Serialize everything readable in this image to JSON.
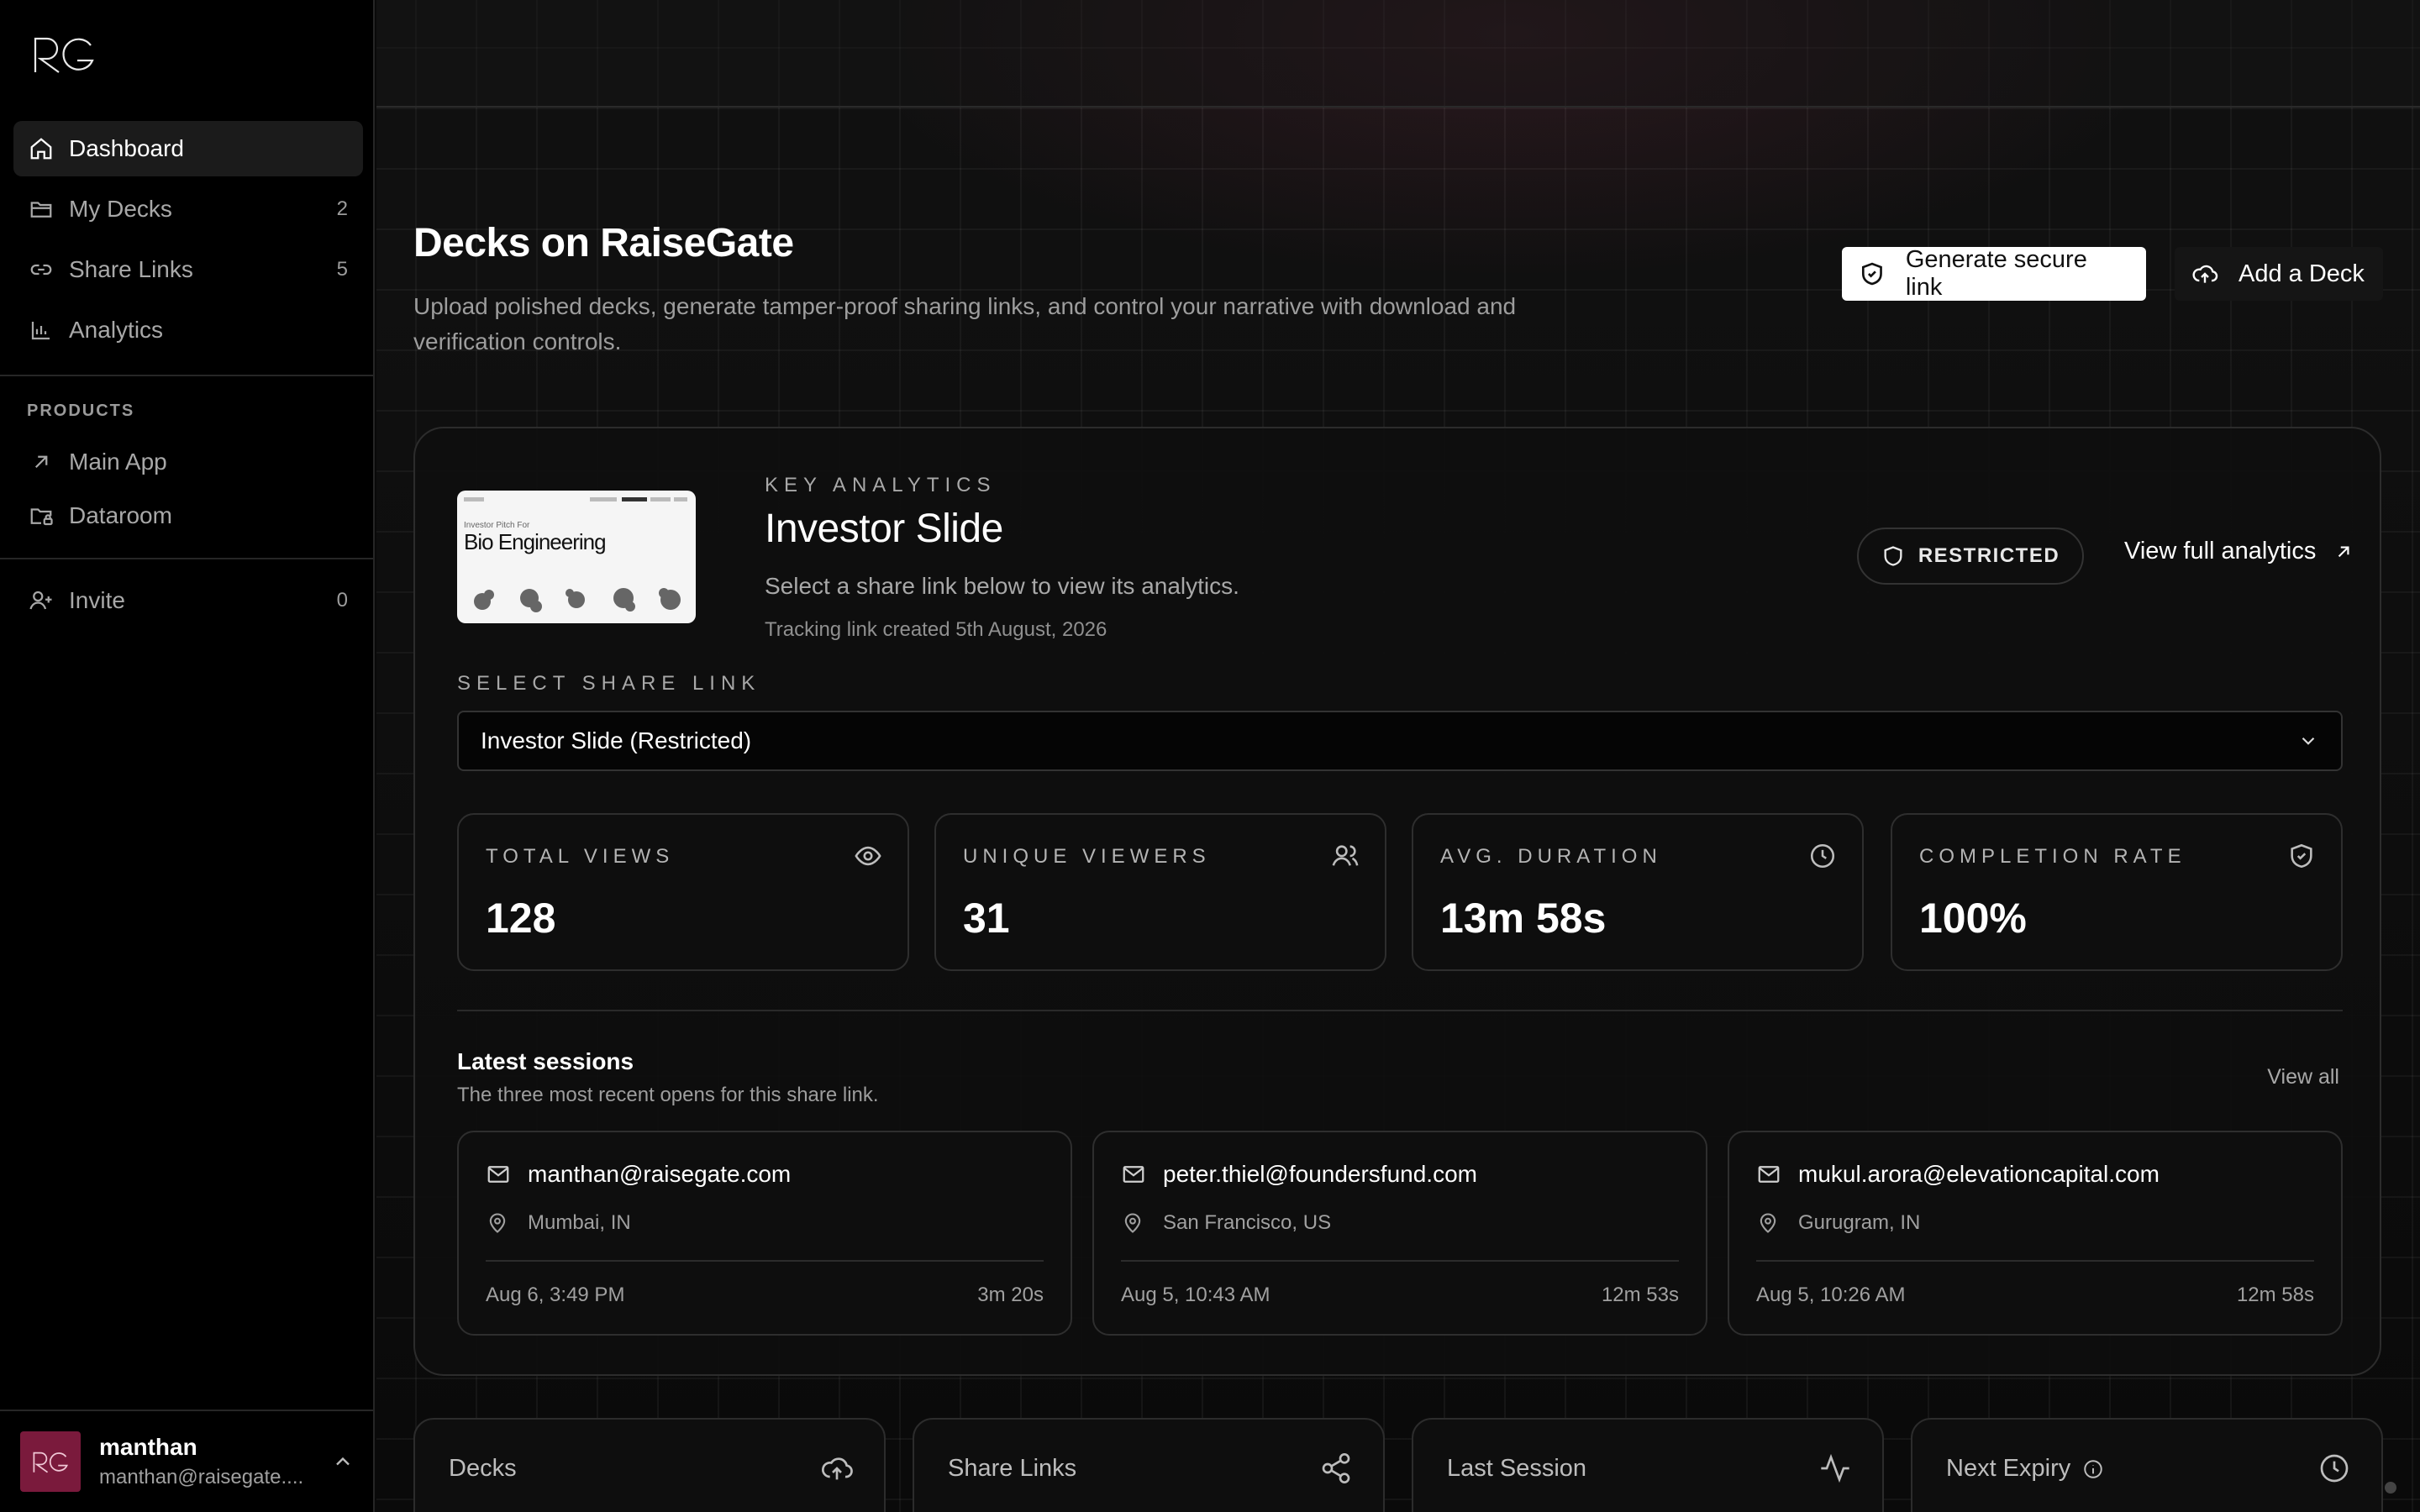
{
  "brand": {
    "logo_text": "RG"
  },
  "sidebar": {
    "nav": [
      {
        "label": "Dashboard",
        "count": "",
        "icon": "home-icon",
        "active": true
      },
      {
        "label": "My Decks",
        "count": "2",
        "icon": "folder-icon"
      },
      {
        "label": "Share Links",
        "count": "5",
        "icon": "link-icon"
      },
      {
        "label": "Analytics",
        "count": "",
        "icon": "bar-chart-icon"
      }
    ],
    "products_label": "PRODUCTS",
    "products": [
      {
        "label": "Main App",
        "icon": "arrow-up-right-icon"
      },
      {
        "label": "Dataroom",
        "icon": "folder-lock-icon"
      }
    ],
    "invite": {
      "label": "Invite",
      "count": "0",
      "icon": "user-plus-icon"
    },
    "user": {
      "name": "manthan",
      "email": "manthan@raisegate...."
    }
  },
  "header": {
    "title": "Decks on RaiseGate",
    "description": "Upload polished decks, generate tamper-proof sharing links, and control your narrative with download and verification controls.",
    "generate_label": "Generate secure link",
    "add_label": "Add a Deck"
  },
  "analytics": {
    "eyebrow": "KEY ANALYTICS",
    "deck_name": "Investor Slide",
    "help": "Select a share link below to view its analytics.",
    "created": "Tracking link created 5th August, 2026",
    "badge": "RESTRICTED",
    "view_full": "View full analytics",
    "thumbnail": {
      "title": "Bio Engineering",
      "subtitle": "Investor Pitch For"
    },
    "select_label": "SELECT SHARE LINK",
    "select_value": "Investor Slide (Restricted)",
    "metrics": [
      {
        "label": "TOTAL VIEWS",
        "value": "128",
        "icon": "eye-icon"
      },
      {
        "label": "UNIQUE VIEWERS",
        "value": "31",
        "icon": "users-icon"
      },
      {
        "label": "AVG. DURATION",
        "value": "13m 58s",
        "icon": "clock-icon"
      },
      {
        "label": "COMPLETION RATE",
        "value": "100%",
        "icon": "shield-check-icon"
      }
    ],
    "sessions_title": "Latest sessions",
    "sessions_sub": "The three most recent opens for this share link.",
    "view_all": "View all",
    "sessions": [
      {
        "email": "manthan@raisegate.com",
        "location": "Mumbai, IN",
        "date": "Aug 6, 3:49 PM",
        "duration": "3m 20s"
      },
      {
        "email": "peter.thiel@foundersfund.com",
        "location": "San Francisco, US",
        "date": "Aug 5, 10:43 AM",
        "duration": "12m 53s"
      },
      {
        "email": "mukul.arora@elevationcapital.com",
        "location": "Gurugram, IN",
        "date": "Aug 5, 10:26 AM",
        "duration": "12m 58s"
      }
    ]
  },
  "summary": [
    {
      "label": "Decks",
      "icon": "cloud-upload-icon"
    },
    {
      "label": "Share Links",
      "icon": "share-icon"
    },
    {
      "label": "Last Session",
      "icon": "activity-icon"
    },
    {
      "label": "Next Expiry",
      "icon": "clock-icon"
    }
  ],
  "colors": {
    "accent_avatar": "#7a1a3c",
    "background": "#0a0a0a",
    "sidebar": "#000000"
  }
}
